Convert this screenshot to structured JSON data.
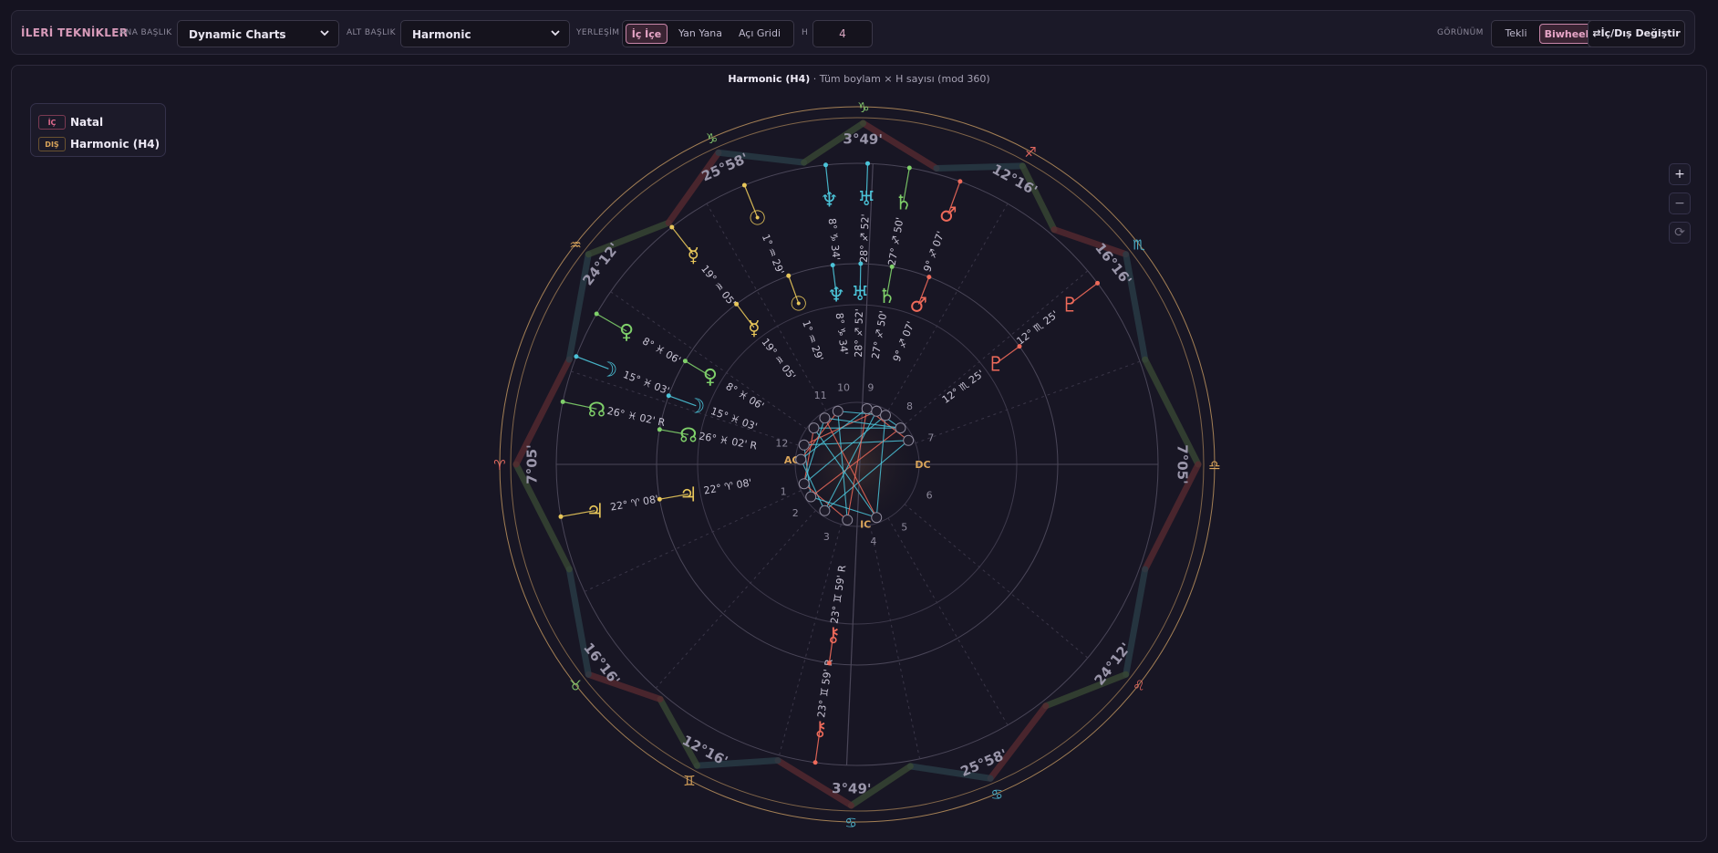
{
  "toolbar": {
    "title": "İLERİ TEKNİKLER",
    "main_heading_label": "ANA BAŞLIK",
    "main_heading_value": "Dynamic Charts",
    "sub_heading_label": "ALT BAŞLIK",
    "sub_heading_value": "Harmonic",
    "layout_label": "YERLEŞİM",
    "layout_options": [
      "İç İçe",
      "Yan Yana",
      "Açı Gridi"
    ],
    "layout_selected": "İç İçe",
    "h_label": "H",
    "h_value": "4",
    "view_label": "GÖRÜNÜM",
    "view_options": [
      "Tekli",
      "Biwheel"
    ],
    "view_selected": "Biwheel",
    "swap_label": "⇄İç/Dış Değiştir"
  },
  "chart_header": {
    "title": "Harmonic (H4)",
    "subtitle": " · Tüm boylam × H sayısı (mod 360)"
  },
  "legend": [
    {
      "tag": "İÇ",
      "text": "Natal",
      "color": "#e36b8f"
    },
    {
      "tag": "DIŞ",
      "text": "Harmonic (H4)",
      "color": "#d9a45a"
    }
  ],
  "zoom": {
    "plus": "+",
    "minus": "−",
    "reset": "⟳"
  },
  "wheel": {
    "sign_degrees": [
      {
        "text": "3°49'",
        "angle": 89,
        "color": "#9a96aa"
      },
      {
        "text": "12°16'",
        "angle": 61,
        "color": "#9a96aa"
      },
      {
        "text": "16°16'",
        "angle": 38,
        "color": "#9a96aa"
      },
      {
        "text": "7°05'",
        "angle": 0,
        "color": "#9a96aa"
      },
      {
        "text": "24°12'",
        "angle": -38,
        "color": "#9a96aa"
      },
      {
        "text": "25°58'",
        "angle": -67,
        "color": "#9a96aa"
      },
      {
        "text": "3°49'",
        "angle": -91,
        "color": "#9a96aa"
      },
      {
        "text": "12°16'",
        "angle": -118,
        "color": "#9a96aa"
      },
      {
        "text": "16°16'",
        "angle": -142,
        "color": "#9a96aa"
      },
      {
        "text": "7°05'",
        "angle": 180,
        "color": "#9a96aa"
      },
      {
        "text": "24°12'",
        "angle": 142,
        "color": "#9a96aa"
      },
      {
        "text": "25°58'",
        "angle": 114,
        "color": "#9a96aa"
      }
    ],
    "sign_glyphs": [
      {
        "glyph": "♑",
        "angle": 89,
        "color": "#7fbf6a"
      },
      {
        "glyph": "♐",
        "angle": 61,
        "color": "#e0675f"
      },
      {
        "glyph": "♏",
        "angle": 38,
        "color": "#4bb0c8"
      },
      {
        "glyph": "♎",
        "angle": 0,
        "color": "#d9a45a"
      },
      {
        "glyph": "♌",
        "angle": -38,
        "color": "#e0675f"
      },
      {
        "glyph": "♋",
        "angle": -67,
        "color": "#4bb0c8"
      },
      {
        "glyph": "♋",
        "angle": -91,
        "color": "#4bb0c8"
      },
      {
        "glyph": "♊",
        "angle": -118,
        "color": "#d9a45a"
      },
      {
        "glyph": "♉",
        "angle": -142,
        "color": "#7fbf6a"
      },
      {
        "glyph": "♈",
        "angle": 180,
        "color": "#e0675f"
      },
      {
        "glyph": "♒",
        "angle": 142,
        "color": "#d9a45a"
      },
      {
        "glyph": "♑",
        "angle": 114,
        "color": "#7fbf6a"
      }
    ],
    "outer_planets": [
      {
        "glyph": "♆",
        "label": "8° ♑ 34'",
        "angle": 96,
        "color": "#4bc3d8"
      },
      {
        "glyph": "♅",
        "label": "28° ♐ 52'",
        "angle": 88,
        "color": "#4bc3d8"
      },
      {
        "glyph": "♄",
        "label": "27° ♐ 50'",
        "angle": 80,
        "color": "#7fd06a"
      },
      {
        "glyph": "♂",
        "label": "9° ♐ 07'",
        "angle": 70,
        "color": "#ee6a5a"
      },
      {
        "glyph": "♇",
        "label": "12° ♏ 25'",
        "angle": 37,
        "color": "#ee6a5a"
      },
      {
        "glyph": "☉",
        "label": "1° ♒ 29'",
        "angle": 112,
        "color": "#e8c75a"
      },
      {
        "glyph": "☿",
        "label": "19° ♒ 05'",
        "angle": 128,
        "color": "#e8c75a"
      },
      {
        "glyph": "♀",
        "label": "8° ♓ 06'",
        "angle": 150,
        "color": "#7fd06a"
      },
      {
        "glyph": "☽",
        "label": "15° ♓ 03'",
        "angle": 159,
        "color": "#4bc3d8"
      },
      {
        "glyph": "☊",
        "label": "26° ♓ 02' R",
        "angle": 168,
        "color": "#7fd06a"
      },
      {
        "glyph": "♃",
        "label": "22° ♈ 08'",
        "angle": 190,
        "color": "#e8c75a"
      },
      {
        "glyph": "⚷",
        "label": "23° ♊ 59' R",
        "angle": 262,
        "color": "#ee6a5a"
      }
    ],
    "inner_planets": [
      {
        "glyph": "♆",
        "label": "8° ♑ 34'",
        "angle": 97,
        "color": "#4bc3d8"
      },
      {
        "glyph": "♅",
        "label": "28° ♐ 52'",
        "angle": 89,
        "color": "#4bc3d8"
      },
      {
        "glyph": "♄",
        "label": "27° ♐ 50'",
        "angle": 80,
        "color": "#7fd06a"
      },
      {
        "glyph": "♂",
        "label": "9° ♐ 07'",
        "angle": 69,
        "color": "#ee6a5a"
      },
      {
        "glyph": "♇",
        "label": "12° ♏ 25'",
        "angle": 36,
        "color": "#ee6a5a"
      },
      {
        "glyph": "☉",
        "label": "1° ♒ 29'",
        "angle": 110,
        "color": "#e8c75a"
      },
      {
        "glyph": "☿",
        "label": "19° ♒ 05'",
        "angle": 127,
        "color": "#e8c75a"
      },
      {
        "glyph": "♀",
        "label": "8° ♓ 06'",
        "angle": 149,
        "color": "#7fd06a"
      },
      {
        "glyph": "☽",
        "label": "15° ♓ 03'",
        "angle": 160,
        "color": "#4bc3d8"
      },
      {
        "glyph": "☊",
        "label": "26° ♓ 02' R",
        "angle": 170,
        "color": "#7fd06a"
      },
      {
        "glyph": "♃",
        "label": "22° ♈ 08'",
        "angle": 190,
        "color": "#e8c75a"
      },
      {
        "glyph": "⚷",
        "label": "23° ♊ 59' R",
        "angle": 262,
        "color": "#ee6a5a"
      }
    ],
    "houses": [
      "1",
      "2",
      "3",
      "4",
      "5",
      "6",
      "7",
      "8",
      "9",
      "10",
      "11",
      "12"
    ],
    "angles": {
      "ac": "AC",
      "dc": "DC",
      "ic": "IC"
    },
    "colors": {
      "ring": "#c89b62",
      "cyan": "#4bc3d8",
      "red": "#ee6a5a",
      "pink": "#e0435f"
    }
  }
}
